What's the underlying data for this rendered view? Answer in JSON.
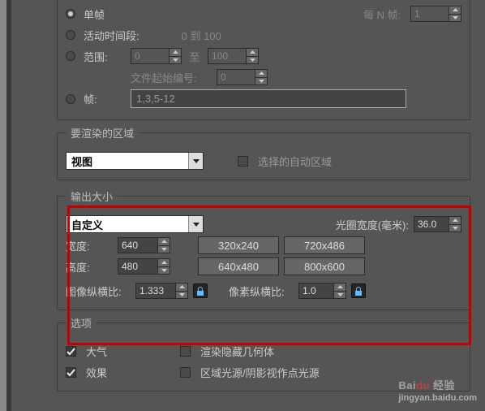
{
  "time": {
    "single": "单帧",
    "every_n_label": "每 N 帧:",
    "every_n_val": "1",
    "active_seg": "活动时间段:",
    "active_range": "0 到 100",
    "range": "范围:",
    "range_from": "0",
    "range_to": "100",
    "range_to_lbl": "至",
    "file_start_lbl": "文件起始编号:",
    "file_start_val": "0",
    "frames": "帧:",
    "frames_val": "1,3,5-12"
  },
  "area": {
    "legend": "要渲染的区域",
    "combo": "视图",
    "auto_region": "选择的自动区域"
  },
  "out": {
    "legend": "输出大小",
    "combo": "自定义",
    "aperture_lbl": "光圈宽度(毫米):",
    "aperture_val": "36.0",
    "width_lbl": "宽度:",
    "width_val": "640",
    "height_lbl": "高度:",
    "height_val": "480",
    "p1": "320x240",
    "p2": "720x486",
    "p3": "640x480",
    "p4": "800x600",
    "img_aspect_lbl": "图像纵横比:",
    "img_aspect_val": "1.333",
    "px_aspect_lbl": "像素纵横比:",
    "px_aspect_val": "1.0"
  },
  "opt": {
    "legend": "选项",
    "atmos": "大气",
    "hide_geo": "渲染隐藏几何体",
    "effects": "效果",
    "area_light": "区域光源/阴影视作点光源"
  },
  "watermark": {
    "brand": "Bai",
    "brand2": "du",
    "prod": "经验",
    "url": "jingyan.baidu.com"
  }
}
